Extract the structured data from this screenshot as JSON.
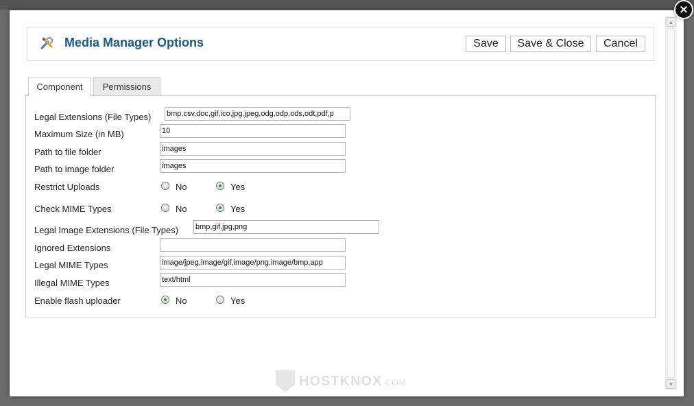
{
  "header": {
    "title": "Media Manager Options",
    "buttons": {
      "save": "Save",
      "save_close": "Save & Close",
      "cancel": "Cancel"
    }
  },
  "close_label": "×",
  "tabs": [
    {
      "label": "Component",
      "active": true
    },
    {
      "label": "Permissions",
      "active": false
    }
  ],
  "form": {
    "legal_extensions": {
      "label": "Legal Extensions (File Types)",
      "value": "bmp,csv,doc,gif,ico,jpg,jpeg,odg,odp,ods,odt,pdf,p"
    },
    "max_size": {
      "label": "Maximum Size (in MB)",
      "value": "10"
    },
    "file_path": {
      "label": "Path to file folder",
      "value": "images"
    },
    "image_path": {
      "label": "Path to image folder",
      "value": "images"
    },
    "restrict_uploads": {
      "label": "Restrict Uploads",
      "no": "No",
      "yes": "Yes",
      "selected": "Yes"
    },
    "check_mime": {
      "label": "Check MIME Types",
      "no": "No",
      "yes": "Yes",
      "selected": "Yes"
    },
    "legal_image_extensions": {
      "label": "Legal Image Extensions (File Types)",
      "value": "bmp,gif,jpg,png"
    },
    "ignored_extensions": {
      "label": "Ignored Extensions",
      "value": ""
    },
    "legal_mime": {
      "label": "Legal MIME Types",
      "value": "image/jpeg,image/gif,image/png,image/bmp,app"
    },
    "illegal_mime": {
      "label": "Illegal MIME Types",
      "value": "text/html"
    },
    "flash_uploader": {
      "label": "Enable flash uploader",
      "no": "No",
      "yes": "Yes",
      "selected": "No"
    }
  },
  "watermark": {
    "brand": "HOSTKNOX",
    "suffix": ".COM"
  },
  "colors": {
    "title": "#185a86",
    "radio_checked": "#2f8f2f"
  }
}
